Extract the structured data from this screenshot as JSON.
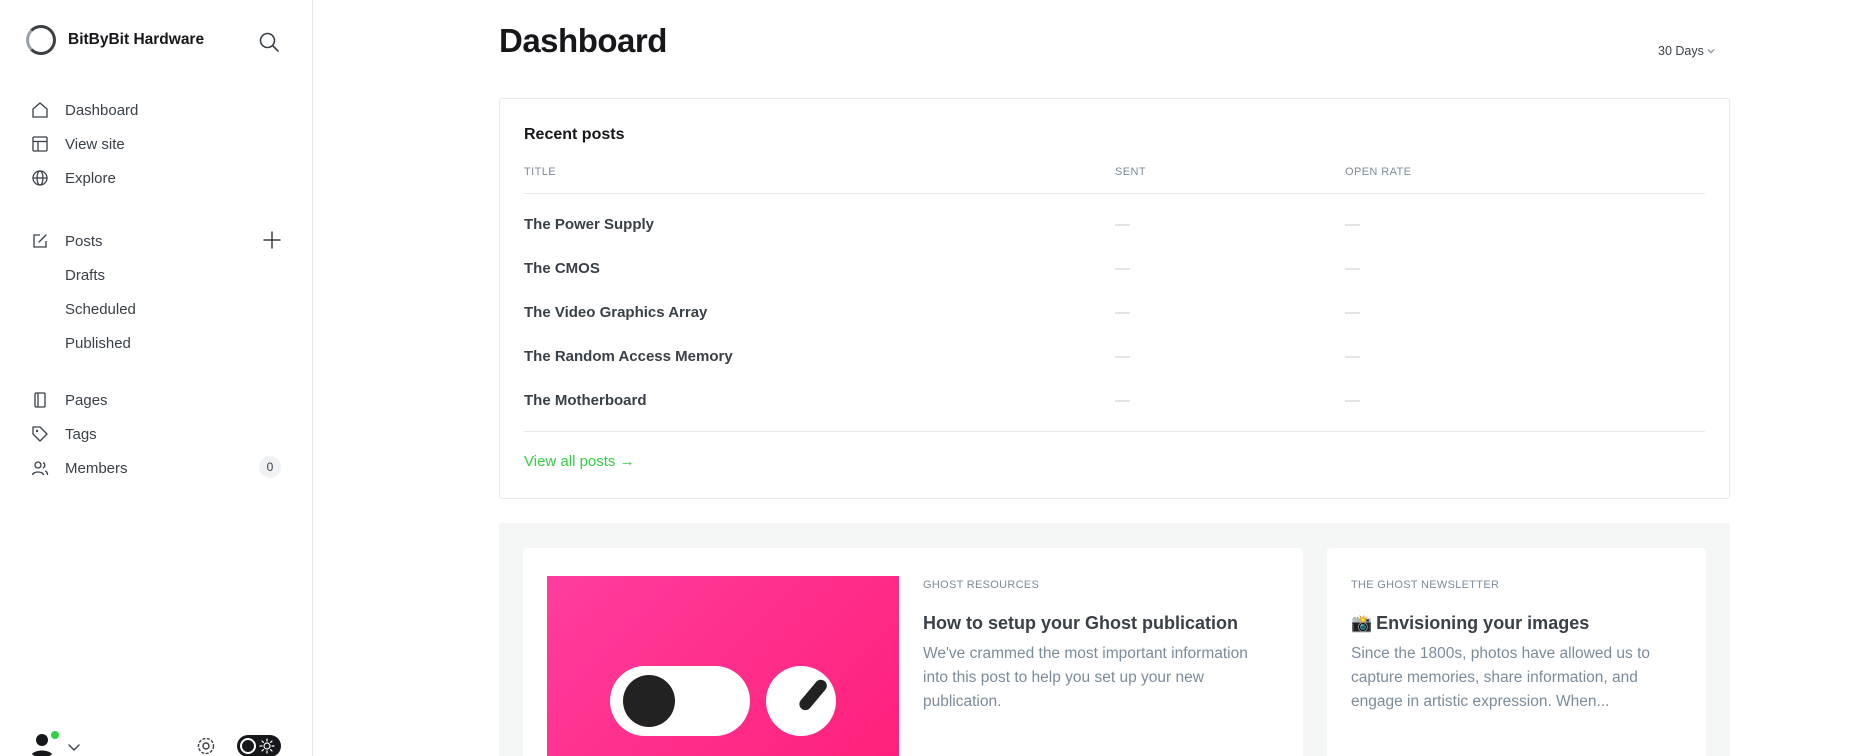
{
  "brand": {
    "name": "BitByBit Hardware"
  },
  "nav": {
    "dashboard": "Dashboard",
    "view_site": "View site",
    "explore": "Explore",
    "posts": "Posts",
    "drafts": "Drafts",
    "scheduled": "Scheduled",
    "published": "Published",
    "pages": "Pages",
    "tags": "Tags",
    "members": "Members",
    "members_count": "0"
  },
  "header": {
    "title": "Dashboard",
    "range": "30 Days"
  },
  "recent_posts": {
    "title": "Recent posts",
    "columns": {
      "title": "TITLE",
      "sent": "SENT",
      "open_rate": "OPEN RATE"
    },
    "rows": [
      {
        "title": "The Power Supply",
        "sent": "—",
        "open_rate": "—"
      },
      {
        "title": "The CMOS",
        "sent": "—",
        "open_rate": "—"
      },
      {
        "title": "The Video Graphics Array",
        "sent": "—",
        "open_rate": "—"
      },
      {
        "title": "The Random Access Memory",
        "sent": "—",
        "open_rate": "—"
      },
      {
        "title": "The Motherboard",
        "sent": "—",
        "open_rate": "—"
      }
    ],
    "view_all": "View all posts →"
  },
  "resources": {
    "featured": {
      "kicker": "GHOST RESOURCES",
      "title": "How to setup your Ghost publication",
      "excerpt_lines": [
        "We've crammed the most important information",
        "into this post to help you set up your new",
        "publication."
      ]
    },
    "newsletter": {
      "kicker": "THE GHOST NEWSLETTER",
      "icon": "camera-flash-emoji",
      "emoji": "📸",
      "title": "Envisioning your images",
      "excerpt_lines": [
        "Since the 1800s, photos have allowed us to",
        "capture memories, share information, and",
        "engage in artistic expression. When..."
      ]
    }
  },
  "colors": {
    "accent": "#30cf43",
    "feature_pink": "#ff1f7a",
    "text_primary": "#15171a",
    "text_muted": "#7c8b9a"
  }
}
